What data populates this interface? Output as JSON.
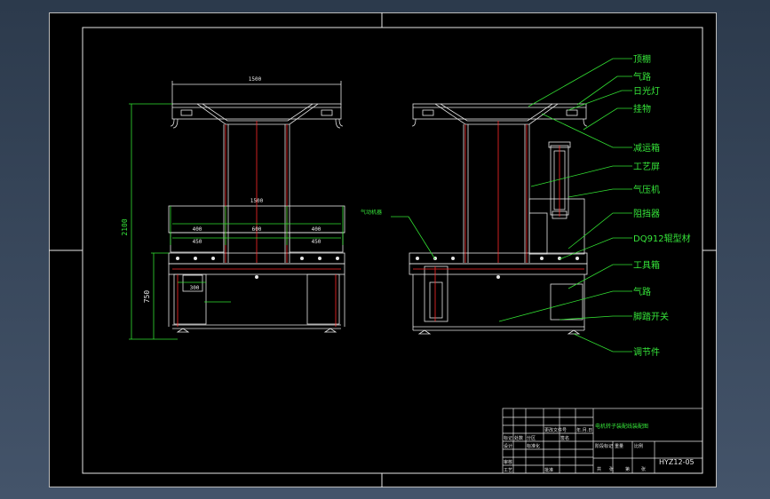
{
  "drawing": {
    "dimensions": {
      "top_width": "1500",
      "mid_width": "1500",
      "height_total": "2100",
      "height_bench": "750",
      "seg_a1": "400",
      "seg_b1": "600",
      "seg_c1": "400",
      "seg_a2": "450",
      "seg_c2": "450",
      "seg_small": "300"
    },
    "left_note": "气动机器",
    "callouts": [
      "顶棚",
      "气路",
      "日光灯",
      "挂物",
      "减运箱",
      "工艺屏",
      "气压机",
      "阻挡器",
      "DQ912辊型材",
      "工具箱",
      "气路",
      "脚踏开关",
      "调节件"
    ]
  },
  "title_block": {
    "title": "电机转子装配线装配图",
    "drawing_no": "HYZ12-05",
    "header_cells": [
      "标记",
      "处数",
      "分区",
      "更改文件号",
      "签名",
      "年.月.日"
    ],
    "role_cells": [
      "设计",
      "审核",
      "工艺",
      "批准",
      "标准化"
    ],
    "stage_cells": [
      "阶段标记",
      "重量",
      "比例"
    ],
    "bottom_cells": [
      "共",
      "张",
      "第",
      "张"
    ]
  },
  "colors": {
    "line": "#e6e6e6",
    "red": "#ff2a2a",
    "green": "#32e032",
    "border": "#e6e6e6"
  }
}
